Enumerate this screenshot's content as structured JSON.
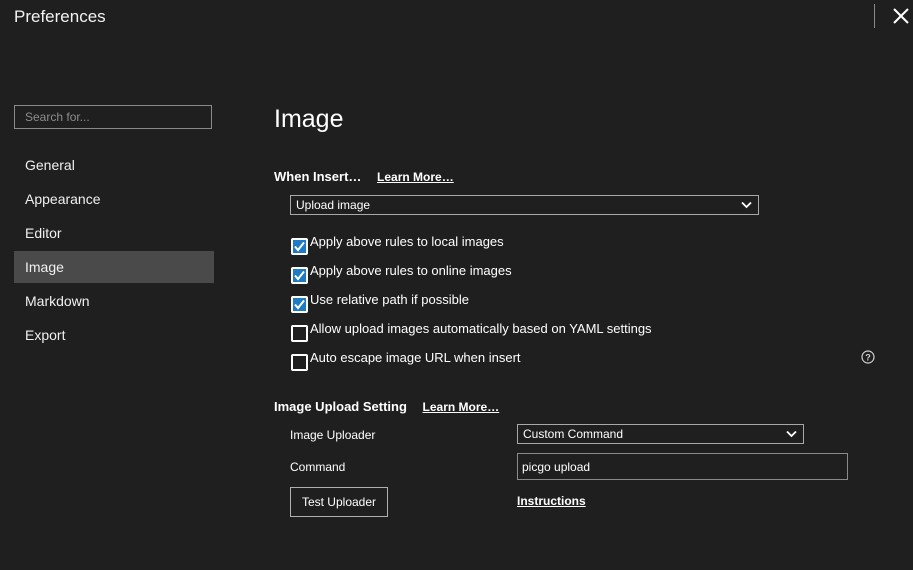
{
  "window": {
    "title": "Preferences",
    "close_icon": "close-icon"
  },
  "sidebar": {
    "search_placeholder": "Search for...",
    "items": [
      {
        "label": "General",
        "active": false
      },
      {
        "label": "Appearance",
        "active": false
      },
      {
        "label": "Editor",
        "active": false
      },
      {
        "label": "Image",
        "active": true
      },
      {
        "label": "Markdown",
        "active": false
      },
      {
        "label": "Export",
        "active": false
      }
    ]
  },
  "main": {
    "title": "Image",
    "when_insert": {
      "heading": "When Insert…",
      "learn_more": "Learn More…",
      "select_value": "Upload image"
    },
    "options": [
      {
        "label": "Apply above rules to local images",
        "checked": true
      },
      {
        "label": "Apply above rules to online images",
        "checked": true
      },
      {
        "label": "Use relative path if possible",
        "checked": true
      },
      {
        "label": "Allow upload images automatically based on YAML settings",
        "checked": false
      },
      {
        "label": "Auto escape image URL when insert",
        "checked": false
      }
    ],
    "help_icon": "question-circle-icon",
    "upload_setting": {
      "heading": "Image Upload Setting",
      "learn_more": "Learn More…",
      "uploader_label": "Image Uploader",
      "uploader_value": "Custom Command",
      "command_label": "Command",
      "command_value": "picgo upload",
      "test_button": "Test Uploader",
      "instructions_link": "Instructions"
    }
  },
  "colors": {
    "background": "#1f1f1f",
    "active_nav": "#4a4a4a",
    "checkbox_accent": "#1e7bc4"
  }
}
